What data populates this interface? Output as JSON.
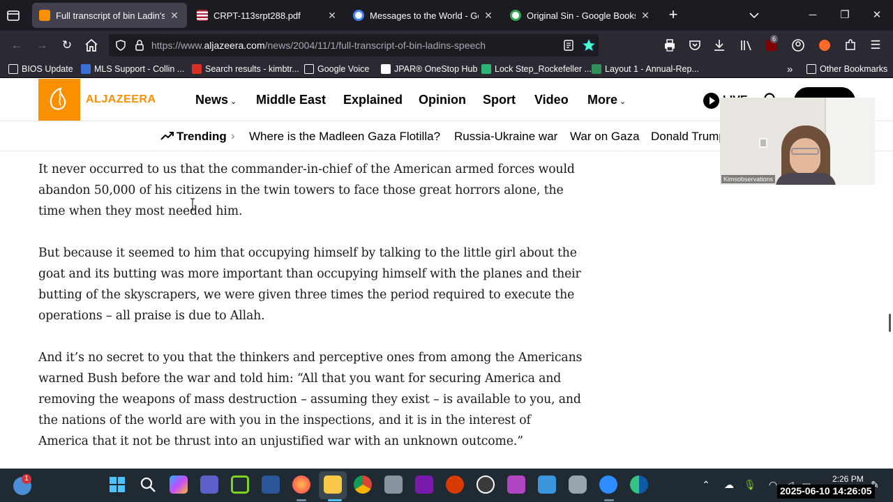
{
  "browser": {
    "tabs": [
      {
        "title": "Full transcript of bin Ladin's spe",
        "active": true
      },
      {
        "title": "CRPT-113srpt288.pdf",
        "active": false
      },
      {
        "title": "Messages to the World - Googl",
        "active": false
      },
      {
        "title": "Original Sin - Google Books",
        "active": false
      }
    ],
    "url_prefix": "https://www.",
    "url_host": "aljazeera.com",
    "url_path": "/news/2004/11/1/full-transcript-of-bin-ladins-speech",
    "extension_badge": "6",
    "bookmarks": [
      {
        "label": "BIOS Update"
      },
      {
        "label": "MLS Support - Collin ..."
      },
      {
        "label": "Search results - kimbtr..."
      },
      {
        "label": "Google Voice"
      },
      {
        "label": "JPAR® OneStop Hub"
      },
      {
        "label": "Lock Step_Rockefeller ..."
      },
      {
        "label": "Layout 1 - Annual-Rep..."
      }
    ],
    "other_bookmarks": "Other Bookmarks"
  },
  "site": {
    "logo_text": "ALJAZEERA",
    "nav": [
      {
        "label": "News",
        "dropdown": true
      },
      {
        "label": "Middle East",
        "dropdown": false
      },
      {
        "label": "Explained",
        "dropdown": false
      },
      {
        "label": "Opinion",
        "dropdown": false
      },
      {
        "label": "Sport",
        "dropdown": false
      },
      {
        "label": "Video",
        "dropdown": false
      },
      {
        "label": "More",
        "dropdown": true
      }
    ],
    "live_label": "LIVE",
    "trending_label": "Trending",
    "trending_items": [
      "Where is the Madleen Gaza Flotilla?",
      "Russia-Ukraine war",
      "War on Gaza",
      "Donald Trump"
    ]
  },
  "article": {
    "paragraphs": [
      "It never occurred to us that the commander-in-chief of the American armed forces would abandon 50,000 of his citizens in the twin towers to face those great horrors alone, the time when they most needed him.",
      "But because it seemed to him that occupying himself by talking to the little girl about the goat and its butting was more important than occupying himself with the planes and their butting of the skyscrapers, we were given three times the period required to execute the operations – all praise is due to Allah.",
      "And it’s no secret to you that the thinkers and perceptive ones from among the Americans warned Bush before the war and told him: “All that you want for securing America and removing the weapons of mass destruction – assuming they exist – is available to you, and the nations of the world are with you in the inspections, and it is in the interest of America that it not be thrust into an unjustified war with an unknown outcome.”"
    ]
  },
  "video_overlay": {
    "name": "Kimsobservations"
  },
  "taskbar": {
    "notification_badge": "1",
    "time": "2:26 PM",
    "date_overlay": "2025-06-10 14:26:05"
  },
  "colors": {
    "brand_orange": "#fa9000",
    "browser_dark": "#1c1b22",
    "taskbar": "#1f2a33"
  }
}
